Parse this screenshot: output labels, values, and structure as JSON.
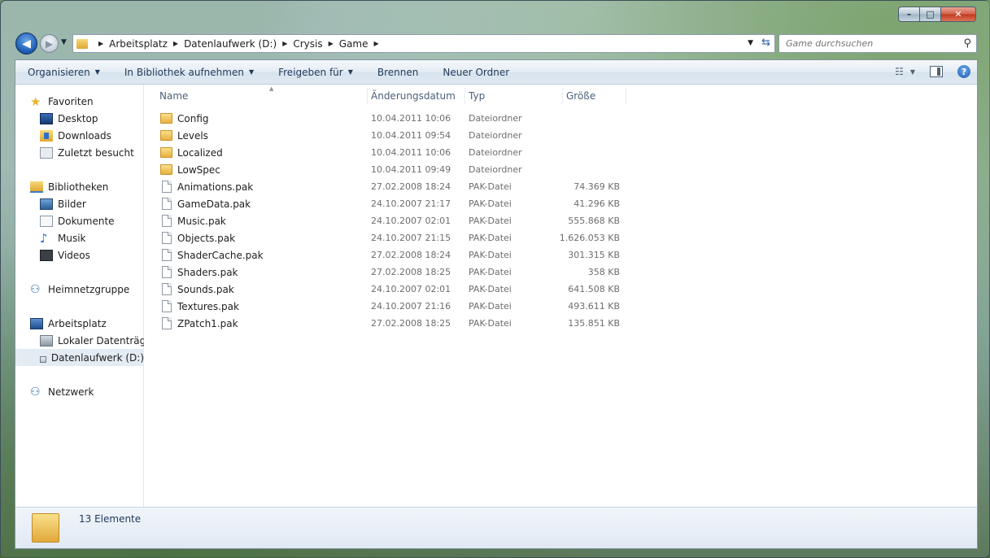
{
  "window_controls": {
    "minimize": "–",
    "maximize": "□",
    "close": "✕"
  },
  "navigation": {
    "back_icon": "◀",
    "forward_icon": "▶",
    "breadcrumb": [
      "Arbeitsplatz",
      "Datenlaufwerk (D:)",
      "Crysis",
      "Game"
    ],
    "search_placeholder": "Game durchsuchen"
  },
  "toolbar": {
    "organize": "Organisieren",
    "library": "In Bibliothek aufnehmen",
    "share": "Freigeben für",
    "burn": "Brennen",
    "new_folder": "Neuer Ordner"
  },
  "sidebar": {
    "favorites": {
      "label": "Favoriten",
      "items": [
        "Desktop",
        "Downloads",
        "Zuletzt besucht"
      ]
    },
    "libraries": {
      "label": "Bibliotheken",
      "items": [
        "Bilder",
        "Dokumente",
        "Musik",
        "Videos"
      ]
    },
    "homegroup": {
      "label": "Heimnetzgruppe"
    },
    "computer": {
      "label": "Arbeitsplatz",
      "items": [
        "Lokaler Datenträger",
        "Datenlaufwerk (D:)"
      ],
      "selected": "Datenlaufwerk (D:)"
    },
    "network": {
      "label": "Netzwerk"
    }
  },
  "columns": {
    "name": "Name",
    "date": "Änderungsdatum",
    "type": "Typ",
    "size": "Größe"
  },
  "files": [
    {
      "name": "Config",
      "date": "10.04.2011 10:06",
      "type": "Dateiordner",
      "size": "",
      "kind": "folder"
    },
    {
      "name": "Levels",
      "date": "10.04.2011 09:54",
      "type": "Dateiordner",
      "size": "",
      "kind": "folder"
    },
    {
      "name": "Localized",
      "date": "10.04.2011 10:06",
      "type": "Dateiordner",
      "size": "",
      "kind": "folder"
    },
    {
      "name": "LowSpec",
      "date": "10.04.2011 09:49",
      "type": "Dateiordner",
      "size": "",
      "kind": "folder"
    },
    {
      "name": "Animations.pak",
      "date": "27.02.2008 18:24",
      "type": "PAK-Datei",
      "size": "74.369 KB",
      "kind": "file"
    },
    {
      "name": "GameData.pak",
      "date": "24.10.2007 21:17",
      "type": "PAK-Datei",
      "size": "41.296 KB",
      "kind": "file"
    },
    {
      "name": "Music.pak",
      "date": "24.10.2007 02:01",
      "type": "PAK-Datei",
      "size": "555.868 KB",
      "kind": "file"
    },
    {
      "name": "Objects.pak",
      "date": "24.10.2007 21:15",
      "type": "PAK-Datei",
      "size": "1.626.053 KB",
      "kind": "file"
    },
    {
      "name": "ShaderCache.pak",
      "date": "27.02.2008 18:24",
      "type": "PAK-Datei",
      "size": "301.315 KB",
      "kind": "file"
    },
    {
      "name": "Shaders.pak",
      "date": "27.02.2008 18:25",
      "type": "PAK-Datei",
      "size": "358 KB",
      "kind": "file"
    },
    {
      "name": "Sounds.pak",
      "date": "24.10.2007 02:01",
      "type": "PAK-Datei",
      "size": "641.508 KB",
      "kind": "file"
    },
    {
      "name": "Textures.pak",
      "date": "24.10.2007 21:16",
      "type": "PAK-Datei",
      "size": "493.611 KB",
      "kind": "file"
    },
    {
      "name": "ZPatch1.pak",
      "date": "27.02.2008 18:25",
      "type": "PAK-Datei",
      "size": "135.851 KB",
      "kind": "file"
    }
  ],
  "status": {
    "count_text": "13 Elemente"
  }
}
